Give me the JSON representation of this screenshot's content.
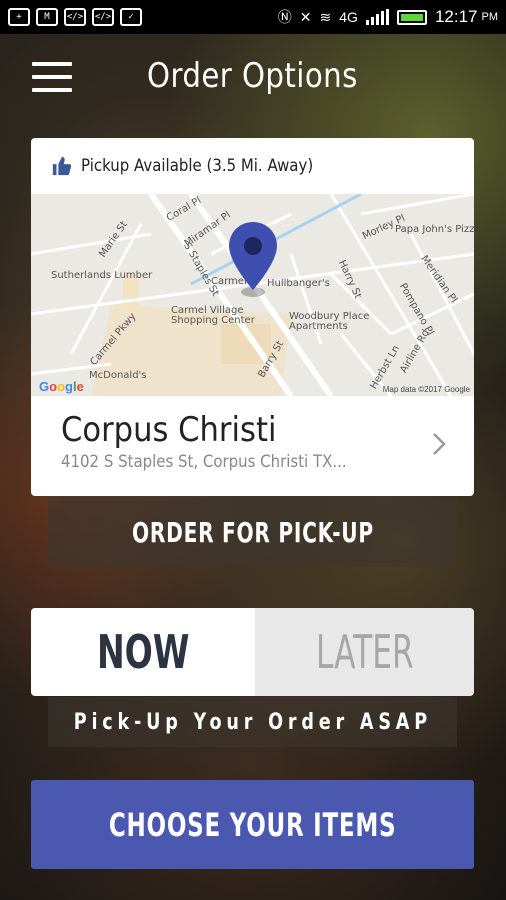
{
  "status_bar": {
    "time": "12:17",
    "ampm": "PM",
    "network": "4G"
  },
  "header": {
    "title": "Order Options",
    "menu_icon": "hamburger-menu-icon"
  },
  "location_card": {
    "pickup_status": "Pickup Available (3.5 Mi. Away)",
    "pickup_icon": "thumbs-up-icon",
    "name": "Corpus Christi",
    "address": "4102 S Staples St, Corpus Christi TX...",
    "map": {
      "labels": {
        "coral_pl": "Coral Pl",
        "miramar_pl": "Miramar Pl",
        "marie_st": "Marie St",
        "s_staples_st": "S Staples St",
        "sutherlands": "Sutherlands Lumber",
        "carmel": "Carmel",
        "hullbangers": "Hullbanger's",
        "carmel_village": "Carmel Village\nShopping Center",
        "carmel_pkwy": "Carmel Pkwy",
        "mcdonalds": "McDonald's",
        "woodbury": "Woodbury Place\nApartments",
        "barry_st": "Barry St",
        "harry_st": "Harry St",
        "morley_pl": "Morley Pl",
        "papa_johns": "Papa John's Pizz",
        "meridian_pl": "Meridian Pl",
        "pompano_pl": "Pompano Pl",
        "airline_rd": "Airline Rd",
        "herbst": "Herbst Ln",
        "google": "Google",
        "attribution": "Map data ©2017 Google"
      }
    }
  },
  "buttons": {
    "order_pickup": "ORDER FOR PICK-UP",
    "choose_items": "CHOOSE YOUR ITEMS"
  },
  "timing": {
    "now": "NOW",
    "later": "LATER",
    "selected": "NOW",
    "description": "Pick-Up Your Order ASAP"
  },
  "colors": {
    "accent": "#4a58b0",
    "marker": "#3f4fb0",
    "thumb": "#3b5998"
  }
}
